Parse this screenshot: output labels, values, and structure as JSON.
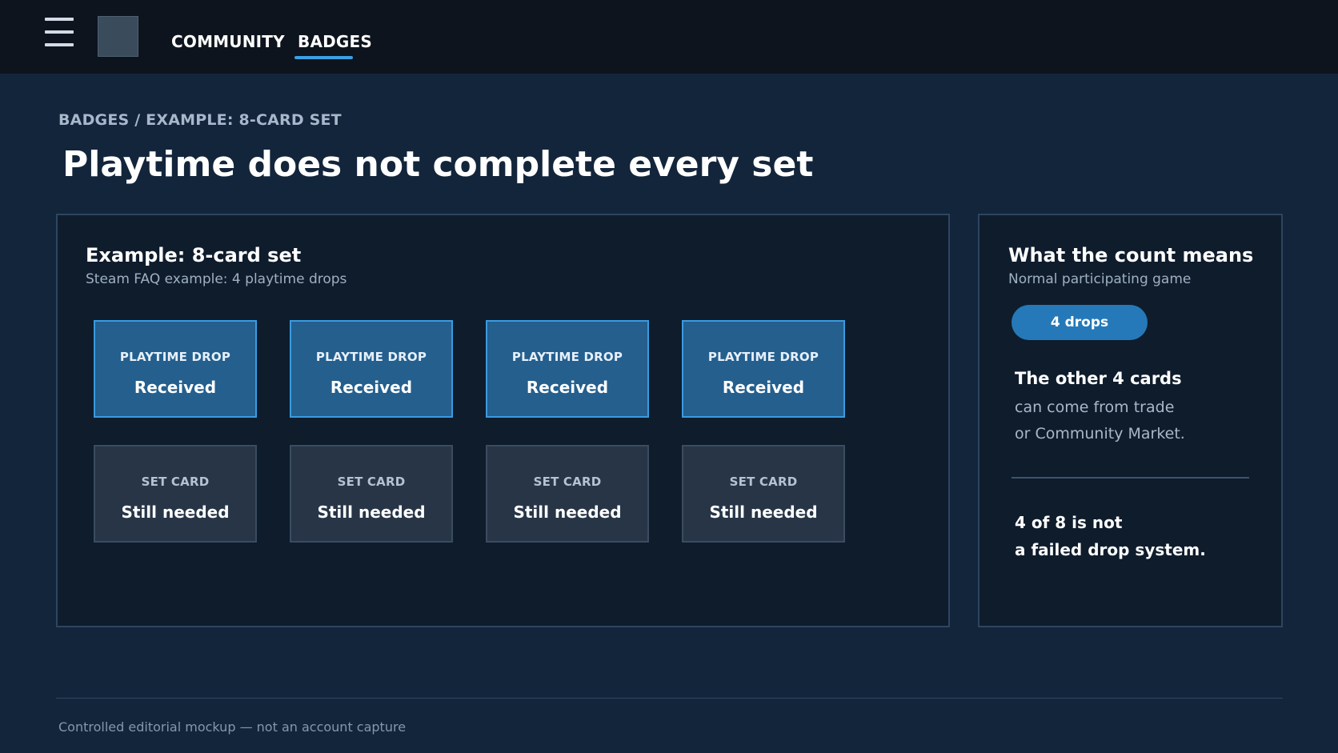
{
  "nav": {
    "tabs": [
      {
        "label": "COMMUNITY",
        "active": false
      },
      {
        "label": "BADGES",
        "active": true
      }
    ],
    "menu_icon": "hamburger-menu-icon",
    "logo_placeholder": "app-logo"
  },
  "breadcrumb": "BADGES / EXAMPLE: 8-CARD SET",
  "page_title": "Playtime does not complete every set",
  "main_panel": {
    "title": "Example: 8-card set",
    "subtitle": "Steam FAQ example: 4 playtime drops",
    "drop_cards": [
      {
        "kicker": "PLAYTIME DROP",
        "status": "Received"
      },
      {
        "kicker": "PLAYTIME DROP",
        "status": "Received"
      },
      {
        "kicker": "PLAYTIME DROP",
        "status": "Received"
      },
      {
        "kicker": "PLAYTIME DROP",
        "status": "Received"
      }
    ],
    "set_cards": [
      {
        "kicker": "SET CARD",
        "status": "Still needed"
      },
      {
        "kicker": "SET CARD",
        "status": "Still needed"
      },
      {
        "kicker": "SET CARD",
        "status": "Still needed"
      },
      {
        "kicker": "SET CARD",
        "status": "Still needed"
      }
    ]
  },
  "side_panel": {
    "title": "What the count means",
    "subtitle": "Normal participating game",
    "pill": "4 drops",
    "heading": "The other 4 cards",
    "body_line1": "can come from trade",
    "body_line2": "or Community Market.",
    "conclusion_line1": "4 of 8 is not",
    "conclusion_line2": "a failed drop system."
  },
  "footer": "Controlled editorial mockup — not an account capture",
  "colors": {
    "page_bg": "#13253b",
    "topbar_bg": "#0d141d",
    "panel_bg": "#0f1c2c",
    "accent": "#3aa0e6",
    "drop_card_bg": "#245f8e",
    "set_card_bg": "#273547",
    "pill_bg": "#2579b8"
  }
}
